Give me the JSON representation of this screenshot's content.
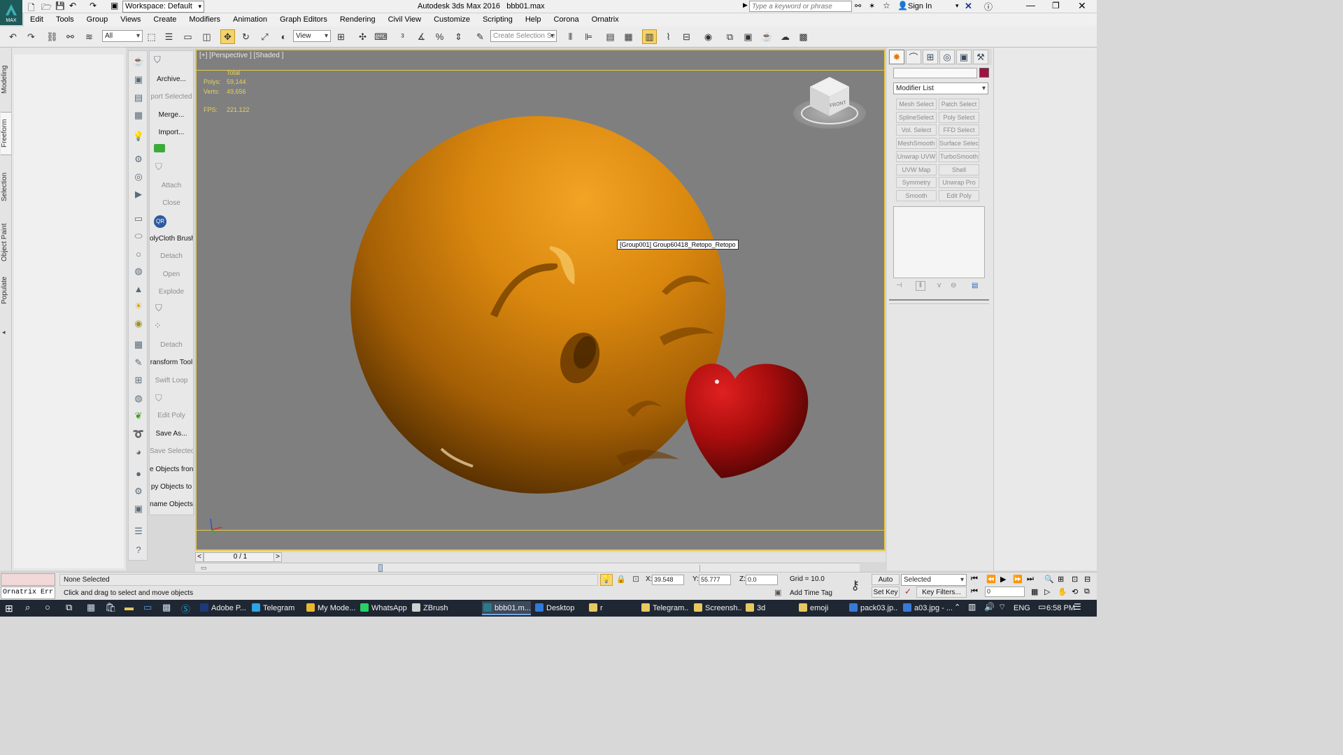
{
  "title": {
    "app": "Autodesk 3ds Max 2016",
    "file": "bbb01.max",
    "workspace": "Workspace: Default",
    "search_placeholder": "Type a keyword or phrase",
    "sign_in": "Sign In"
  },
  "menu": [
    "Edit",
    "Tools",
    "Group",
    "Views",
    "Create",
    "Modifiers",
    "Animation",
    "Graph Editors",
    "Rendering",
    "Civil View",
    "Customize",
    "Scripting",
    "Help",
    "Corona",
    "Ornatrix"
  ],
  "toolbar": {
    "selection_filter": "All",
    "ref_coord": "View",
    "named_selection_placeholder": "Create Selection Se"
  },
  "left_tabs": [
    "Modeling",
    "Freeform",
    "Selection",
    "Object Paint",
    "Populate"
  ],
  "tool_labels": [
    {
      "label": "Archive...",
      "enabled": true
    },
    {
      "label": "port Selected",
      "enabled": false
    },
    {
      "label": "Merge...",
      "enabled": true
    },
    {
      "label": "Import...",
      "enabled": true
    },
    {
      "label": "Attach",
      "enabled": false
    },
    {
      "label": "Close",
      "enabled": false
    },
    {
      "label": "olyCloth Brush",
      "enabled": true
    },
    {
      "label": "Detach",
      "enabled": false
    },
    {
      "label": "Open",
      "enabled": false
    },
    {
      "label": "Explode",
      "enabled": false
    },
    {
      "label": "Detach",
      "enabled": false
    },
    {
      "label": "ransform Tool",
      "enabled": true
    },
    {
      "label": "Swift Loop",
      "enabled": false
    },
    {
      "label": "Edit Poly",
      "enabled": false
    },
    {
      "label": "Save As...",
      "enabled": true
    },
    {
      "label": "Save Selected",
      "enabled": false
    },
    {
      "label": "e Objects fron",
      "enabled": true
    },
    {
      "label": "py Objects to",
      "enabled": true
    },
    {
      "label": "name Objects",
      "enabled": true
    }
  ],
  "viewport": {
    "label": "[+] [Perspective ] [Shaded ]",
    "stats": {
      "total": "Total",
      "polys_label": "Polys:",
      "polys": "59,144",
      "verts_label": "Verts:",
      "verts": "49,656",
      "fps_label": "FPS:",
      "fps": "221.122"
    },
    "tooltip": "[Group001] Group60418_Retopo_Retopo",
    "viewcube_label": "FRONT",
    "colors": {
      "emoji": "#d98a10",
      "heart": "#b01010",
      "background": "#7f7f7f"
    }
  },
  "command_panel": {
    "modifier_list": "Modifier List",
    "modifiers": [
      "Mesh Select",
      "Patch Select",
      "SplineSelect",
      "Poly Select",
      "Vol. Select",
      "FFD Select",
      "MeshSmooth",
      "Surface Select",
      "Unwrap UVW",
      "TurboSmooth",
      "UVW Map",
      "Shell",
      "Symmetry",
      "Unwrap Pro",
      "Smooth",
      "Edit Poly"
    ]
  },
  "timeline": {
    "frame": "0 / 1",
    "prev": "<",
    "next": ">"
  },
  "status": {
    "selection": "None Selected",
    "prompt": "Click and drag to select and move objects",
    "maxscript": "Ornatrix Err",
    "x_label": "X:",
    "x": "39.548",
    "y_label": "Y:",
    "y": "55.777",
    "z_label": "Z:",
    "z": "0.0",
    "grid": "Grid = 10.0",
    "add_time_tag": "Add Time Tag",
    "auto_key": "Auto Key",
    "set_key": "Set Key",
    "key_mode": "Selected",
    "key_filters": "Key Filters...",
    "current_frame": "0"
  },
  "taskbar": {
    "apps": [
      {
        "label": "Adobe P...",
        "color": "#1a3a7a",
        "active": false
      },
      {
        "label": "Telegram",
        "color": "#2ca5e0",
        "active": false
      },
      {
        "label": "My Mode...",
        "color": "#e8b830",
        "active": false
      },
      {
        "label": "WhatsApp",
        "color": "#25d366",
        "active": false
      },
      {
        "label": "ZBrush",
        "color": "#d0d0d0",
        "active": false
      },
      {
        "label": "bbb01.m...",
        "color": "#2a7a8a",
        "active": true
      },
      {
        "label": "Desktop",
        "color": "#2f7bd6",
        "active": false
      },
      {
        "label": "r",
        "color": "#e8c860",
        "active": false
      },
      {
        "label": "Telegram...",
        "color": "#e8c860",
        "active": false
      },
      {
        "label": "Screensh...",
        "color": "#e8c860",
        "active": false
      },
      {
        "label": "3d",
        "color": "#e8c860",
        "active": false
      },
      {
        "label": "emoji",
        "color": "#e8c860",
        "active": false
      },
      {
        "label": "pack03.jp...",
        "color": "#3a7ad6",
        "active": false
      },
      {
        "label": "a03.jpg - ...",
        "color": "#3a7ad6",
        "active": false
      }
    ],
    "language": "ENG",
    "time": "6:58 PM"
  }
}
